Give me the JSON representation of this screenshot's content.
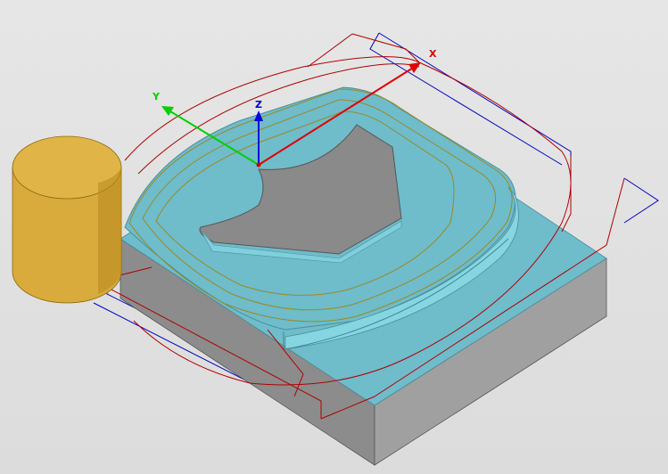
{
  "viewport": {
    "background": "#e0e0e0"
  },
  "axes": {
    "x_label": "X",
    "y_label": "Y",
    "z_label": "Z",
    "x_color": "#e00000",
    "y_color": "#00d000",
    "z_color": "#0000e0"
  },
  "colors": {
    "part_top": "#6fbccb",
    "part_top_light": "#7fcfdc",
    "part_side_front": "#8c8c8c",
    "part_side_right": "#a8a8a8",
    "pocket_floor": "#8a8a8a",
    "tool_body": "#d9aa3c",
    "tool_top": "#e0b447",
    "toolpath_red": "#b00000",
    "toolpath_blue": "#0000c0",
    "toolpath_olive": "#9a8a20"
  }
}
